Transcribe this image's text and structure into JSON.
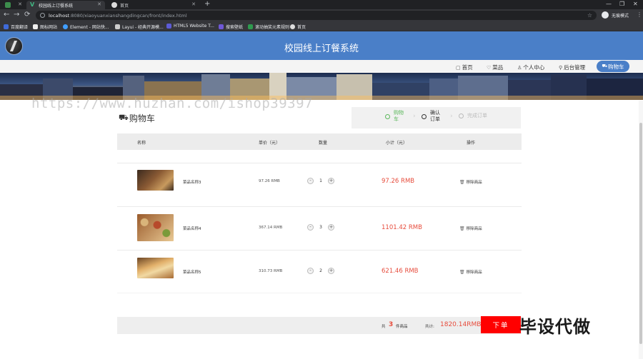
{
  "browser": {
    "tabs": [
      {
        "title": "",
        "icon": "browser-app-icon",
        "active": false
      },
      {
        "title": "校园线上订餐系统",
        "icon": "vue-icon",
        "active": true
      },
      {
        "title": "首页",
        "icon": "globe-icon",
        "active": false
      }
    ],
    "new_tab": "+",
    "window_controls": [
      "—",
      "❐",
      "✕"
    ],
    "url_host": "localhost",
    "url_path": ":8080/xiaoyuanxianshangdingcan/front/index.html",
    "profile_label": "无痕模式",
    "bookmarks": [
      {
        "label": "百度翻译",
        "icon": "translate-icon",
        "color": "#3f6ad8"
      },
      {
        "label": "图标网站",
        "icon": "image-icon",
        "color": "#eeeeee"
      },
      {
        "label": "Element - 网站快...",
        "icon": "element-icon",
        "color": "#409eff"
      },
      {
        "label": "Layui - 经典开源模...",
        "icon": "layui-icon",
        "color": "#cccccc"
      },
      {
        "label": "HTML5 Website T...",
        "icon": "html5-icon",
        "color": "#5c5bd6"
      },
      {
        "label": "搜索壁纸",
        "icon": "wallpaper-icon",
        "color": "#6f58d6"
      },
      {
        "label": "滚动抽奖元素规则",
        "icon": "lottery-icon",
        "color": "#2e9a4e"
      },
      {
        "label": "首页",
        "icon": "globe-icon",
        "color": "#dddddd"
      }
    ]
  },
  "site": {
    "title": "校园线上订餐系统",
    "nav": [
      {
        "label": "首页",
        "icon": "home-icon",
        "glyph": "▢"
      },
      {
        "label": "菜品",
        "icon": "heart-icon",
        "glyph": "♡"
      },
      {
        "label": "个人中心",
        "icon": "user-icon",
        "glyph": "♙"
      },
      {
        "label": "后台管理",
        "icon": "link-icon",
        "glyph": "⚲"
      }
    ],
    "nav_cart": {
      "label": "购物车",
      "icon": "cart-icon",
      "glyph": "🛒"
    }
  },
  "watermark_url": "https://www.huzhan.com/ishop39397",
  "cart": {
    "heading": "购物车",
    "steps": [
      {
        "label_1": "购物",
        "label_2": "车",
        "state": "done"
      },
      {
        "label_1": "确认",
        "label_2": "订单",
        "state": "current"
      },
      {
        "label_1": "完成订单",
        "label_2": "",
        "state": "todo"
      }
    ],
    "columns": [
      "名称",
      "单价（元）",
      "数量",
      "小计（元）",
      "操作"
    ],
    "items": [
      {
        "name": "菜品名称3",
        "unit_price": "97.26 RMB",
        "qty": "1",
        "subtotal": "97.26 RMB",
        "remove": "移除商品",
        "thumb_colors": [
          "#3b2a1e",
          "#8a5a34",
          "#c89a5e"
        ]
      },
      {
        "name": "菜品名称4",
        "unit_price": "367.14 RMB",
        "qty": "3",
        "subtotal": "1101.42 RMB",
        "remove": "移除商品",
        "thumb_colors": [
          "#9a5b2c",
          "#d9b47a",
          "#b74a2b"
        ]
      },
      {
        "name": "菜品名称5",
        "unit_price": "310.73 RMB",
        "qty": "2",
        "subtotal": "621.46 RMB",
        "remove": "移除商品",
        "thumb_colors": [
          "#6b4524",
          "#e2b06a",
          "#f1d9a3"
        ]
      }
    ],
    "footer": {
      "prefix": "共",
      "count": "3",
      "suffix": "件商品",
      "total_label": "共计:",
      "total": "1820.14RMB",
      "order_button": "下单"
    }
  },
  "watermark_brand": "毕设代做"
}
